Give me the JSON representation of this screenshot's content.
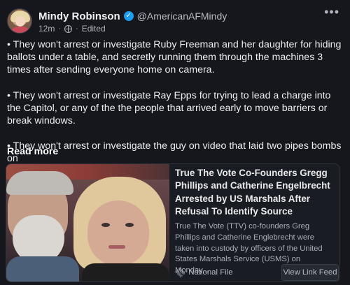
{
  "post": {
    "author_name": "Mindy Robinson",
    "handle": "@AmericanAFMindy",
    "time": "12m",
    "separator": "·",
    "edited": "Edited",
    "more_icon": "•••",
    "verified_icon": "check-icon"
  },
  "body": {
    "paragraphs": [
      "• They won't arrest or investigate Ruby Freeman and her daughter for hiding ballots under a table, and secretly running them through the machines 3 times after sending everyone home on camera.",
      "• They won't arrest or investigate Ray Epps for trying to lead a charge into the Capitol, or any of the the people that arrived early to move barriers or break windows.",
      "• They won't arrest or investigate the guy on video that laid two pipes bombs on"
    ],
    "read_more": "Read more"
  },
  "card": {
    "title": "True The Vote Co-Founders Gregg Phillips and Catherine Engelbrecht Arrested by US Marshals After Refusal To Identify Source",
    "summary": "True The Vote (TTV) co-founders Greg Phillips and Catherine Englebrecht were taken into custody by officers of the United States Marshals Service (USMS) on Monday...",
    "source": "National File",
    "button": "View Link Feed"
  },
  "colors": {
    "background": "#15171c",
    "verified": "#1d9bf0",
    "card_border": "#30333b"
  }
}
